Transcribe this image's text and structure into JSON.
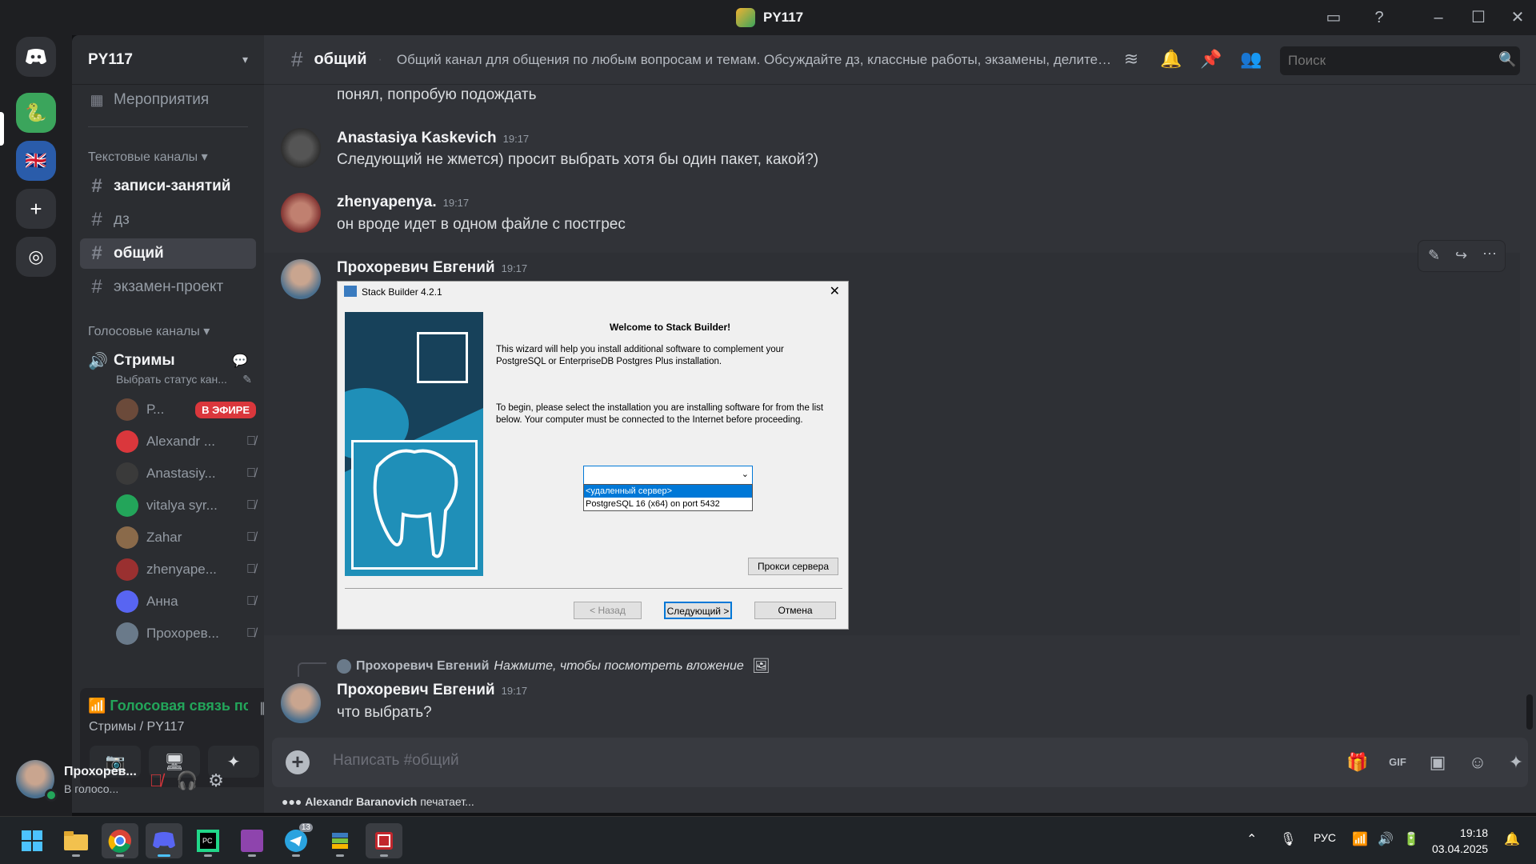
{
  "window": {
    "title": "PY117"
  },
  "rail": {
    "servers": [
      {
        "icon": "discord-logo-icon"
      },
      {
        "icon": "python-server-icon"
      },
      {
        "icon": "uk-flag-server-icon"
      },
      {
        "icon": "add-server-icon"
      },
      {
        "icon": "compass-icon"
      }
    ]
  },
  "sidebar": {
    "server_name": "PY117",
    "events_label": "Мероприятия",
    "text_category": "Текстовые каналы",
    "text_channels": [
      {
        "name": "записи-занятий",
        "state": "unread"
      },
      {
        "name": "дз",
        "state": "normal"
      },
      {
        "name": "общий",
        "state": "active"
      },
      {
        "name": "экзамен-проект",
        "state": "normal"
      }
    ],
    "voice_category": "Голосовые каналы",
    "voice_channel": {
      "name": "Стримы",
      "status": "Выбрать статус кан..."
    },
    "voice_users": [
      {
        "name": "Р...",
        "badge": "В ЭФИРЕ",
        "color": "#6b4a3a"
      },
      {
        "name": "Alexandr ...",
        "color": "#da373c"
      },
      {
        "name": "Anastasiy...",
        "color": "#3a3a3a"
      },
      {
        "name": "vitalya syr...",
        "color": "#23a55a"
      },
      {
        "name": "Zahar",
        "color": "#8a6a4a"
      },
      {
        "name": "zhenyape...",
        "color": "#9a3030"
      },
      {
        "name": "Анна",
        "color": "#5865f2"
      },
      {
        "name": "Прохорев...",
        "color": "#6a7a8a"
      }
    ]
  },
  "voice_panel": {
    "status": "Голосовая связь пс",
    "location": "Стримы / PY117"
  },
  "user_panel": {
    "name": "Прохорев...",
    "status": "В голосо..."
  },
  "channel_header": {
    "name": "общий",
    "topic": "Общий канал для общения по любым вопросам и темам. Обсуждайте дз, классные работы, экзамены, делитесь..."
  },
  "search": {
    "placeholder": "Поиск"
  },
  "messages": {
    "m0": {
      "text": "понял, попробую подождать"
    },
    "m1": {
      "author": "Anastasiya Kaskevich",
      "time": "19:17",
      "text": "Следующий не жмется) просит выбрать хотя бы один пакет, какой?)"
    },
    "m2": {
      "author": "zhenyapenya.",
      "time": "19:17",
      "text": "он вроде идет в одном файле с постгрес"
    },
    "m3": {
      "author": "Прохоревич Евгений",
      "time": "19:17"
    },
    "reply": {
      "author": "Прохоревич Евгений",
      "text": "Нажмите, чтобы посмотреть вложение"
    },
    "m4": {
      "author": "Прохоревич Евгений",
      "time": "19:17",
      "text": "что выбрать?"
    }
  },
  "attachment": {
    "title": "Stack Builder 4.2.1",
    "welcome": "Welcome to Stack Builder!",
    "para1": "This wizard will help you install additional software to complement your PostgreSQL or EnterpriseDB Postgres Plus installation.",
    "para2": "To begin, please select the installation you are installing software for from the list below. Your computer must be connected to the Internet before proceeding.",
    "options": [
      "<удаленный сервер>",
      "PostgreSQL 16 (x64) on port 5432"
    ],
    "proxy_btn": "Прокси сервера",
    "back_btn": "< Назад",
    "next_btn": "Следующий >",
    "cancel_btn": "Отмена"
  },
  "composer": {
    "placeholder": "Написать #общий"
  },
  "typing": {
    "user": "Alexandr Baranovich",
    "text": "печатает..."
  },
  "taskbar": {
    "lang": "РУС",
    "time": "19:18",
    "date": "03.04.2025",
    "telegram_badge": "13"
  }
}
